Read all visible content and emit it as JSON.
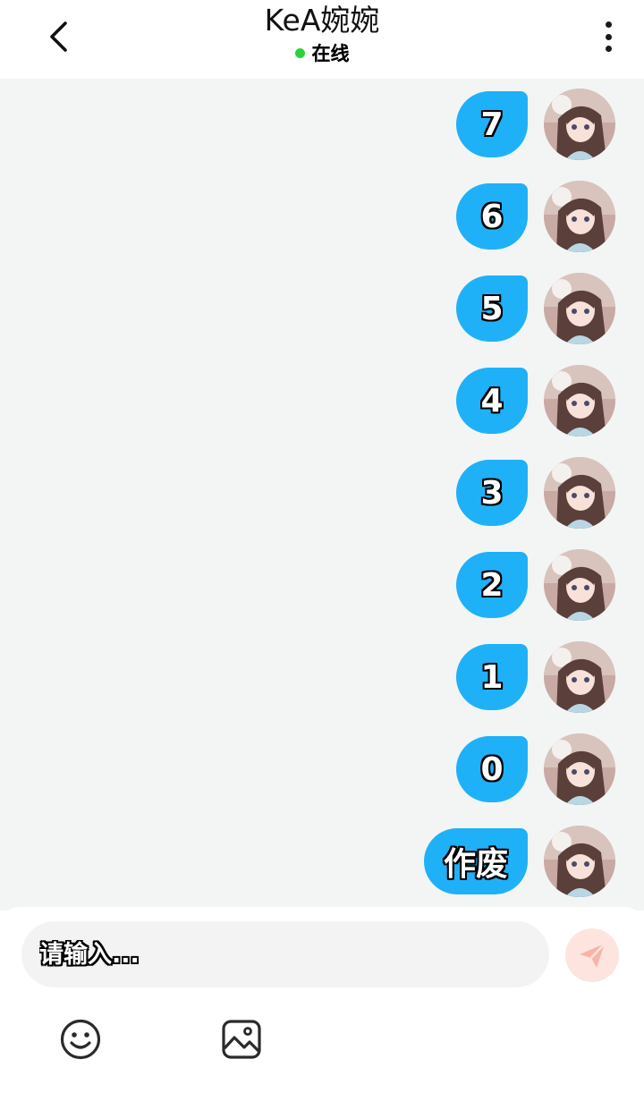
{
  "header": {
    "title": "KeA婉婉",
    "status": "在线",
    "status_color": "#2bd23b",
    "back_icon": "chevron-left-icon",
    "more_icon": "more-vertical-icon"
  },
  "colors": {
    "bubble": "#1fb1f8",
    "chat_background": "#f3f5f5",
    "send_button": "#fde4df",
    "send_icon": "#f6b5a8"
  },
  "messages": [
    {
      "text": "7",
      "sender": "self"
    },
    {
      "text": "6",
      "sender": "self"
    },
    {
      "text": "5",
      "sender": "self"
    },
    {
      "text": "4",
      "sender": "self"
    },
    {
      "text": "3",
      "sender": "self"
    },
    {
      "text": "2",
      "sender": "self"
    },
    {
      "text": "1",
      "sender": "self"
    },
    {
      "text": "0",
      "sender": "self"
    },
    {
      "text": "作废",
      "sender": "self"
    }
  ],
  "composer": {
    "placeholder": "请输入...",
    "value": "",
    "send_icon": "send-icon",
    "emoji_icon": "emoji-icon",
    "image_icon": "image-icon"
  }
}
